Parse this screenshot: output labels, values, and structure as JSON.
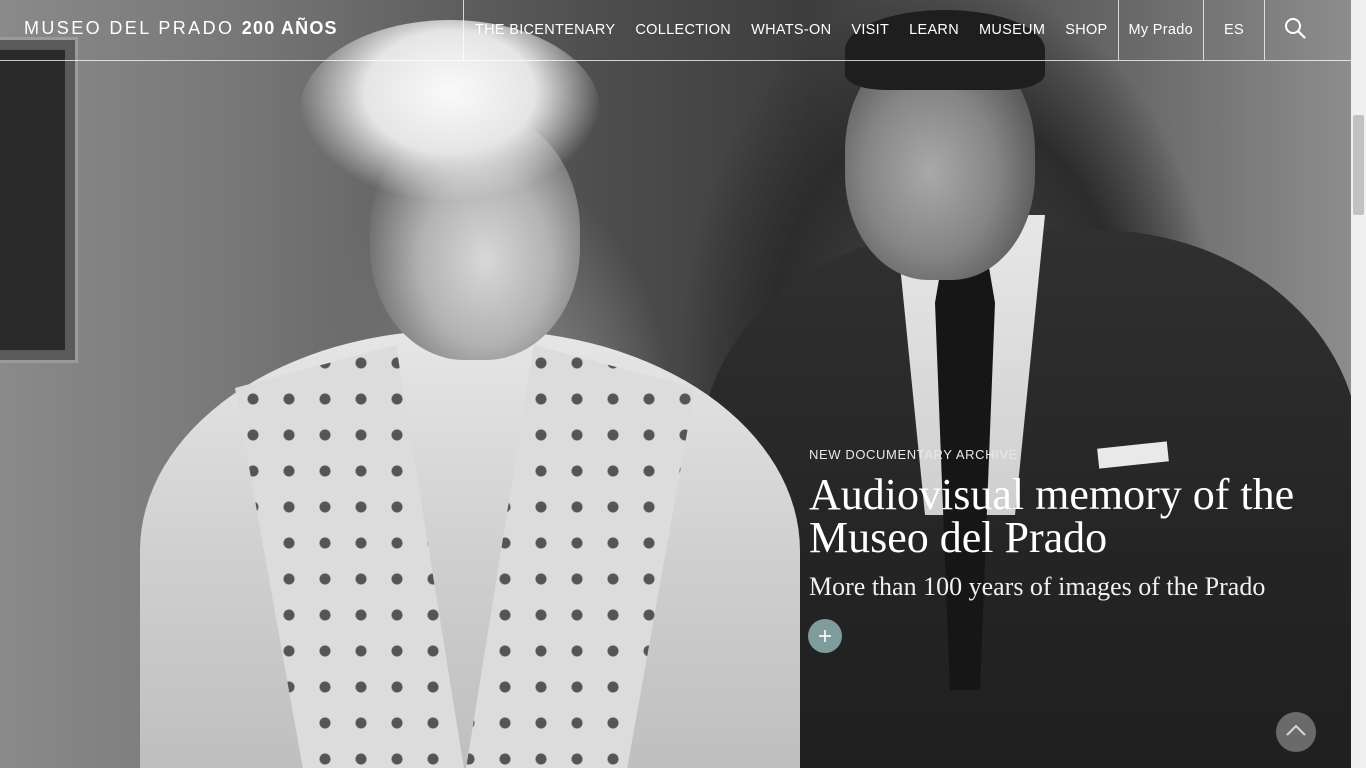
{
  "header": {
    "brand_name": "MUSEO DEL PRADO",
    "brand_years": "200 AÑOS",
    "nav": [
      {
        "label": "THE BICENTENARY"
      },
      {
        "label": "COLLECTION"
      },
      {
        "label": "WHATS-ON"
      },
      {
        "label": "VISIT"
      },
      {
        "label": "LEARN"
      },
      {
        "label": "MUSEUM"
      },
      {
        "label": "SHOP"
      }
    ],
    "account_label": "My Prado",
    "language_label": "ES",
    "search_icon": "search-icon"
  },
  "feature": {
    "kicker": "NEW DOCUMENTARY ARCHIVE",
    "title": "Audiovisual memory of the Museo del Prado",
    "subtitle": "More than 100 years of images of the Prado",
    "more_icon": "plus-icon"
  },
  "back_to_top_icon": "chevron-up-icon",
  "colors": {
    "accent_button": "#7e9c9b",
    "text": "#ffffff"
  }
}
